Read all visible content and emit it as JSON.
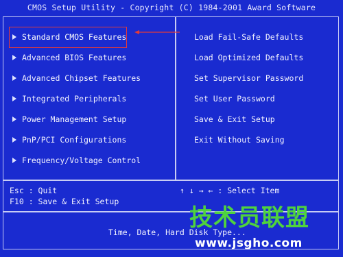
{
  "window": {
    "title": "CMOS Setup Utility - Copyright (C) 1984-2001 Award Software"
  },
  "left_menu": [
    {
      "label": "Standard CMOS Features",
      "selected": true
    },
    {
      "label": "Advanced BIOS Features",
      "selected": false
    },
    {
      "label": "Advanced Chipset Features",
      "selected": false
    },
    {
      "label": "Integrated Peripherals",
      "selected": false
    },
    {
      "label": "Power Management Setup",
      "selected": false
    },
    {
      "label": "PnP/PCI Configurations",
      "selected": false
    },
    {
      "label": "Frequency/Voltage Control",
      "selected": false
    }
  ],
  "right_menu": [
    {
      "label": "Load Fail-Safe Defaults"
    },
    {
      "label": "Load Optimized Defaults"
    },
    {
      "label": "Set Supervisor Password"
    },
    {
      "label": "Set User Password"
    },
    {
      "label": "Save & Exit Setup"
    },
    {
      "label": "Exit Without Saving"
    }
  ],
  "help": {
    "esc": "Esc : Quit",
    "f10": "F10 : Save & Exit Setup",
    "nav": "↑ ↓ → ←   : Select Item"
  },
  "status_bar": {
    "text": "Time, Date, Hard Disk Type..."
  },
  "watermark": {
    "brand": "技术员联盟",
    "url": "www.jsgho.com",
    "color": "#4fd23e"
  },
  "colors": {
    "background": "#1a2bd0",
    "border": "#c8ccf4",
    "highlight": "#e23a3a"
  }
}
